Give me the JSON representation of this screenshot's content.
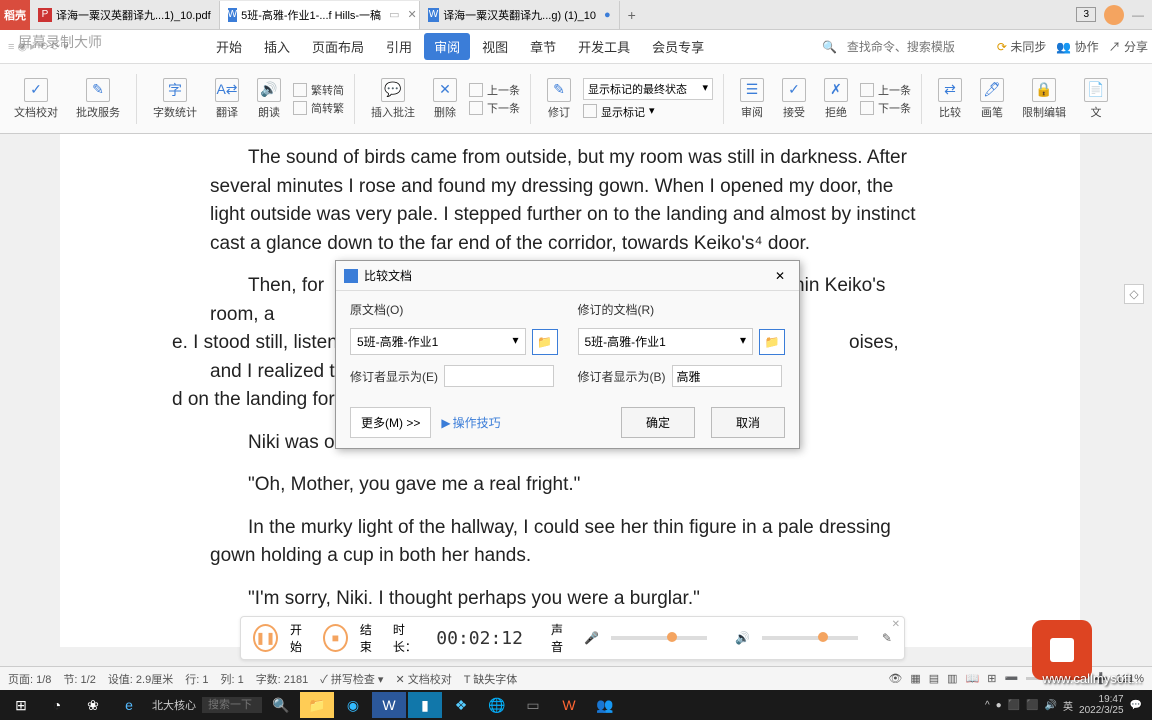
{
  "app_name": "稻壳",
  "tabs": [
    {
      "label": "译海一粟汉英翻译九...1)_10.pdf",
      "type": "pdf"
    },
    {
      "label": "5班-高雅-作业1-...f Hills-一稿",
      "type": "doc",
      "active": true
    },
    {
      "label": "译海一粟汉英翻译九...g) (1)_10",
      "type": "doc"
    }
  ],
  "window_count": "3",
  "menu": [
    "开始",
    "插入",
    "页面布局",
    "引用",
    "审阅",
    "视图",
    "章节",
    "开发工具",
    "会员专享"
  ],
  "menu_active": "审阅",
  "search_placeholder": "查找命令、搜索模版",
  "sync": "未同步",
  "collab": "协作",
  "share": "分享",
  "ribbon": {
    "doc_check": "文档校对",
    "mod_service": "批改服务",
    "word_count": "字数统计",
    "translate": "翻译",
    "read_aloud": "朗读",
    "s2t": "繁转简",
    "t2s": "简转繁",
    "insert_comment": "插入批注",
    "delete": "删除",
    "track": "修订",
    "prev": "上一条",
    "next": "下一条",
    "track_display_label": "显示标记的最终状态",
    "show_markup": "显示标记",
    "review": "审阅",
    "accept": "接受",
    "reject": "拒绝",
    "compare": "比较",
    "ink": "画笔",
    "restrict": "限制编辑",
    "doc_final": "文"
  },
  "document": {
    "p1": "The sound of birds came from outside, but my room was still in darkness. After several minutes I rose and found my dressing gown. When I opened my door, the light outside was very pale. I stepped further on to the landing and almost by instinct cast a glance down to the far end of the corridor, towards Keiko's⁴  door.",
    "p2a": "Then, for",
    "p2b": "hin Keiko's room, a",
    "p2c": "e. I stood still, listening, t",
    "p2d": "oises, and I realized t",
    "p2e": "d on the landing for a m",
    "p3": "Niki was o",
    "p4": "\"Oh, Mother, you gave me a real fright.\"",
    "p5": "In the murky light of the hallway, I could see her thin figure in a pale dressing gown holding a cup in both her hands.",
    "p6": "\"I'm sorry, Niki. I thought perhaps you were a burglar.\""
  },
  "dialog": {
    "title": "比较文档",
    "original_label": "原文档(O)",
    "revised_label": "修订的文档(R)",
    "original_value": "5班-高雅-作业1",
    "revised_value": "5班-高雅-作业1",
    "editor_label_e": "修订者显示为(E)",
    "editor_label_b": "修订者显示为(B)",
    "editor_value_b": "高雅",
    "more": "更多(M) >>",
    "tips": "操作技巧",
    "ok": "确定",
    "cancel": "取消"
  },
  "recorder": {
    "start": "开始",
    "end": "结束",
    "duration_label": "时长：",
    "duration": "00:02:12",
    "sound": "声音"
  },
  "status": {
    "page": "页面: 1/8",
    "section": "节: 1/2",
    "pos": "设值: 2.9厘米",
    "line": "行: 1",
    "col": "列: 1",
    "words": "字数: 2181",
    "spell": "拼写检查",
    "doc_check": "文档校对",
    "missing_font": "缺失字体",
    "zoom": "121%"
  },
  "taskbar": {
    "browser_text": "北大核心",
    "search": "搜索一下",
    "ime": "英",
    "time": "19:47",
    "date": "2022/3/25"
  },
  "watermark": "www.callmysoft...",
  "watermark2": "屏幕录制大师"
}
